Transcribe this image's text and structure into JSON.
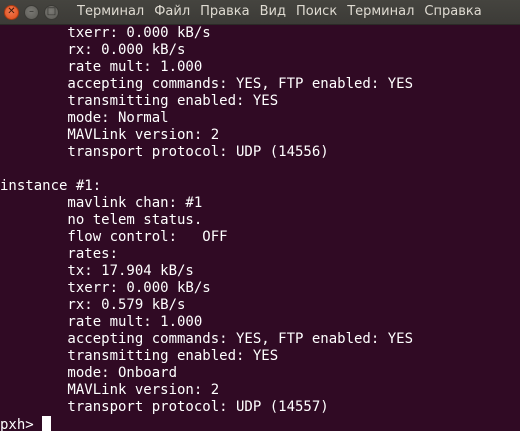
{
  "window": {
    "buttons": {
      "close_glyph": "✕",
      "minimize_glyph": "–",
      "maximize_glyph": "□"
    },
    "colors": {
      "terminal_bg": "#300a24",
      "terminal_fg": "#ffffff",
      "titlebar_bg": "#3c3b37",
      "close_button": "#df4a16"
    }
  },
  "menu": {
    "items": [
      "Терминал",
      "Файл",
      "Правка",
      "Вид",
      "Поиск",
      "Терминал",
      "Справка"
    ]
  },
  "terminal": {
    "lines": [
      "        txerr: 0.000 kB/s",
      "        rx: 0.000 kB/s",
      "        rate mult: 1.000",
      "        accepting commands: YES, FTP enabled: YES",
      "        transmitting enabled: YES",
      "        mode: Normal",
      "        MAVLink version: 2",
      "        transport protocol: UDP (14556)",
      "",
      "instance #1:",
      "        mavlink chan: #1",
      "        no telem status.",
      "        flow control:   OFF",
      "        rates:",
      "        tx: 17.904 kB/s",
      "        txerr: 0.000 kB/s",
      "        rx: 0.579 kB/s",
      "        rate mult: 1.000",
      "        accepting commands: YES, FTP enabled: YES",
      "        transmitting enabled: YES",
      "        mode: Onboard",
      "        MAVLink version: 2",
      "        transport protocol: UDP (14557)"
    ],
    "prompt": "pxh> "
  }
}
